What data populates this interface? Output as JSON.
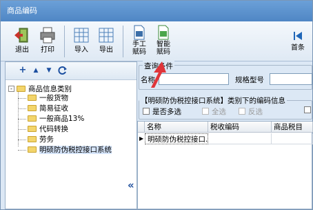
{
  "window": {
    "title": "商品编码"
  },
  "toolbar": {
    "exit": "退出",
    "print": "打印",
    "import": "导入",
    "export": "导出",
    "manual_1": "手工",
    "manual_2": "赋码",
    "smart_1": "智能",
    "smart_2": "赋码",
    "first": "首条"
  },
  "tree": {
    "root": "商品信息类别",
    "expander": "-",
    "items": [
      "一般货物",
      "简易征收",
      "一般商品13%",
      "代码转换",
      "劳务",
      "明硕防伪税控接口系统"
    ]
  },
  "query": {
    "title": "查询条件",
    "name_label": "名称",
    "spec_label": "规格型号"
  },
  "codes": {
    "title": "【明硕防伪税控接口系统】类别下的编码信息",
    "multi_select": "是否多选",
    "select_all": "全选",
    "invert": "反选"
  },
  "grid": {
    "columns": [
      "名称",
      "税收编码",
      "商品税目"
    ],
    "rows": [
      [
        "明硕防伪税控接口...",
        "",
        ""
      ]
    ]
  },
  "colors": {
    "title_bar": "#5a92cf",
    "accent_red": "#e0353a"
  },
  "icons": [
    "exit-icon",
    "print-icon",
    "import-icon",
    "export-icon",
    "manual-code-icon",
    "smart-code-icon",
    "first-record-icon",
    "add-icon",
    "move-up-icon",
    "move-down-icon",
    "refresh-icon",
    "folder-icon",
    "collapse-arrow-icon"
  ]
}
